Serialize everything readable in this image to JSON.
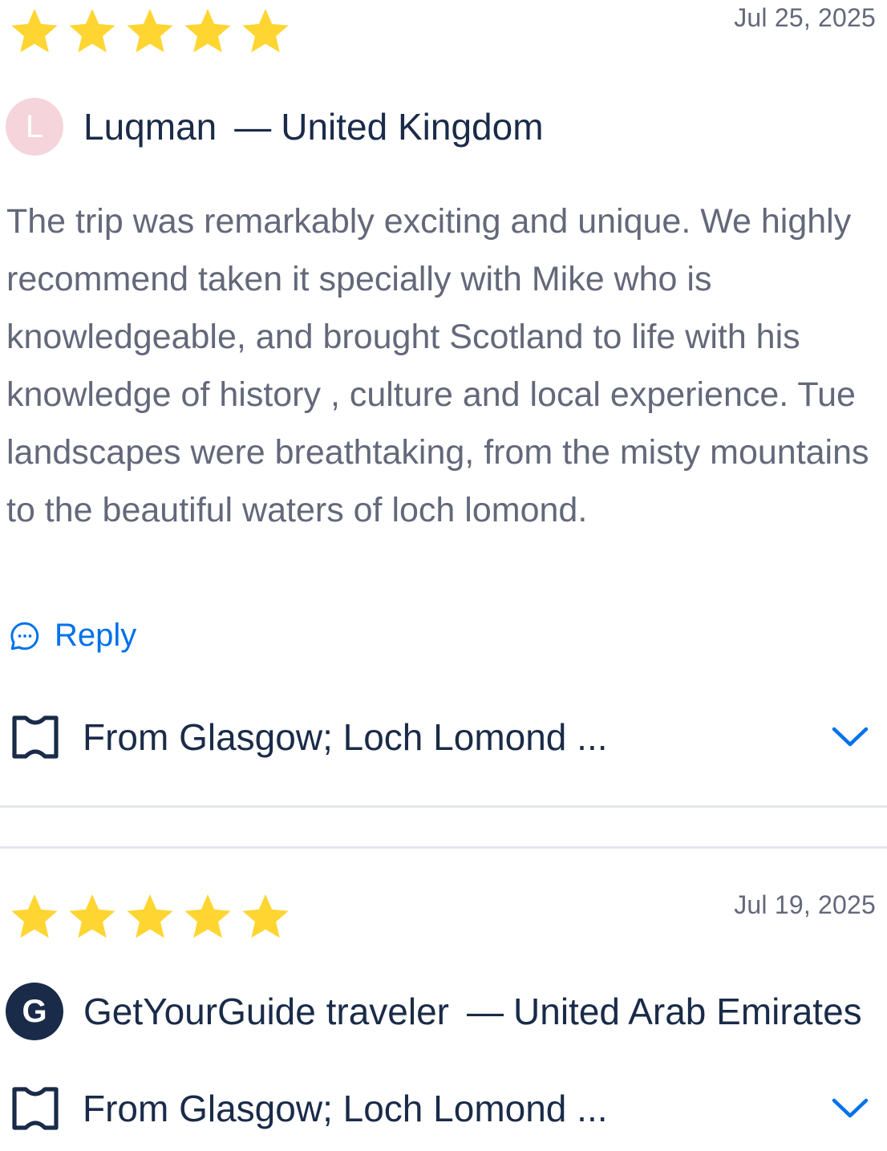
{
  "colors": {
    "star": "#ffd531",
    "text_primary": "#1a2b49",
    "text_secondary": "#63687a",
    "link": "#0071eb",
    "divider": "#e4e6ec"
  },
  "reviews": [
    {
      "rating": 5,
      "rating_max": 5,
      "date": "Jul 25, 2025",
      "avatar_letter": "L",
      "author": "Luqman",
      "separator": "—",
      "country": "United Kingdom",
      "text": "The trip was remarkably exciting and unique. We highly recommend taken it specially with Mike who is knowledgeable, and brought Scotland to life with his knowledge of history , culture and local experience. Tue landscapes were breathtaking, from the misty mountains to the beautiful waters of loch lomond.",
      "reply_label": "Reply",
      "activity": "From Glasgow; Loch Lomond ..."
    },
    {
      "rating": 5,
      "rating_max": 5,
      "date": "Jul 19, 2025",
      "avatar_letter": "G",
      "author": "GetYourGuide traveler",
      "separator": "—",
      "country": "United Arab Emirates",
      "activity": "From Glasgow; Loch Lomond ..."
    }
  ],
  "icons": {
    "star": "star-icon",
    "reply": "chat-bubble-icon",
    "activity": "ticket-icon",
    "expand": "chevron-down-icon"
  }
}
